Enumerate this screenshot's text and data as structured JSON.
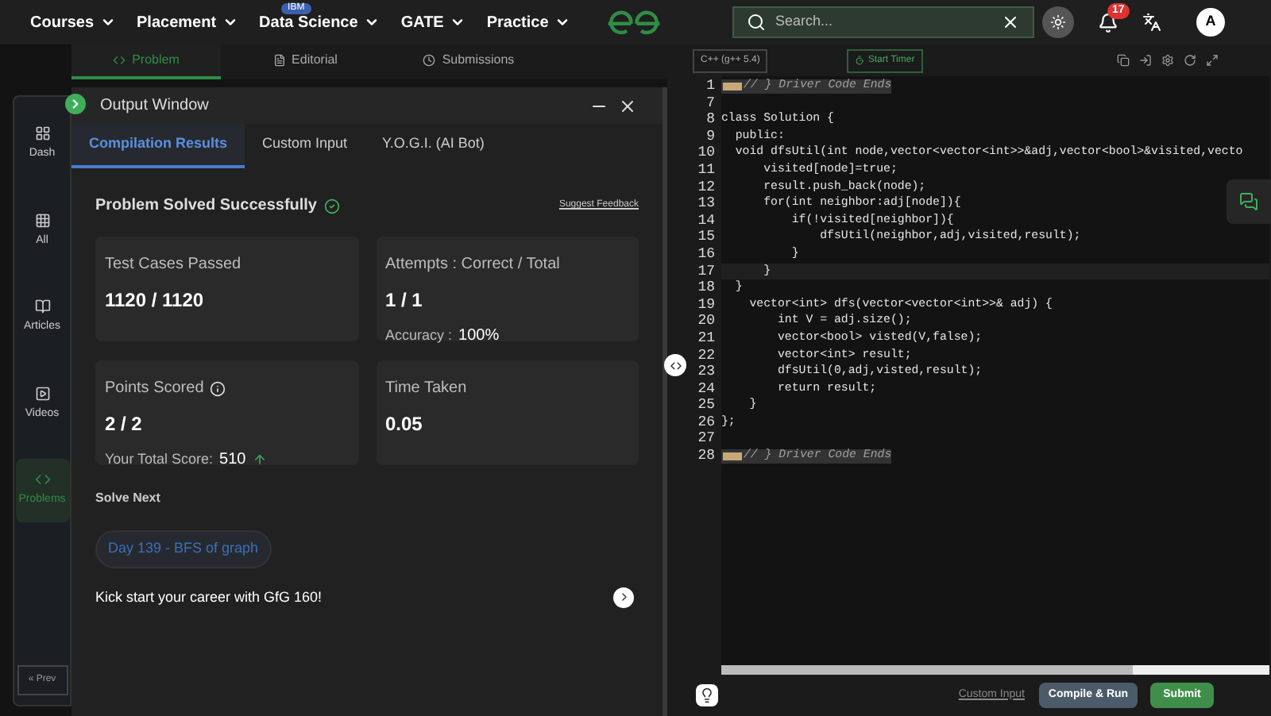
{
  "nav": {
    "items": [
      {
        "label": "Courses"
      },
      {
        "label": "Placement"
      },
      {
        "label": "Data Science",
        "badge": "IBM"
      },
      {
        "label": "GATE"
      },
      {
        "label": "Practice"
      }
    ],
    "search": {
      "placeholder": "Search..."
    },
    "notifications": "17",
    "avatar": "A"
  },
  "problem_tabs": [
    {
      "label": "Problem",
      "selected": true
    },
    {
      "label": "Editorial",
      "selected": false
    },
    {
      "label": "Submissions",
      "selected": false
    }
  ],
  "sidebar": {
    "items": [
      {
        "label": "Dash",
        "selected": false
      },
      {
        "label": "All",
        "selected": false
      },
      {
        "label": "Articles",
        "selected": false
      },
      {
        "label": "Videos",
        "selected": false
      },
      {
        "label": "Problems",
        "selected": true
      }
    ],
    "prev": "« Prev"
  },
  "output": {
    "title": "Output Window",
    "tabs": [
      {
        "label": "Compilation Results",
        "selected": true
      },
      {
        "label": "Custom Input",
        "selected": false
      },
      {
        "label": "Y.O.G.I. (AI Bot)",
        "selected": false
      }
    ],
    "status": "Problem Solved Successfully",
    "feedback": "Suggest Feedback",
    "cards": [
      {
        "title": "Test Cases Passed",
        "value": "1120 / 1120"
      },
      {
        "title": "Attempts : Correct / Total",
        "value": "1 / 1",
        "note_label": "Accuracy :",
        "note_value": "100%"
      },
      {
        "title": "Points Scored",
        "value": "2 / 2",
        "info": true,
        "note_label": "Your Total Score:",
        "note_value": "510",
        "trend_up": true
      },
      {
        "title": "Time Taken",
        "value": "0.05"
      }
    ],
    "solve_next": "Solve Next",
    "next_problem": "Day 139 - BFS of graph",
    "promo": "Kick start your career with GfG 160!"
  },
  "editor": {
    "language": "C++ (g++ 5.4)",
    "timer": "Start Timer",
    "lines": [
      {
        "number": "1",
        "kind": "comment",
        "text": "// } Driver Code Ends",
        "active": false
      },
      {
        "number": "7",
        "kind": "code",
        "active": false
      },
      {
        "number": "8",
        "kind": "code",
        "text": "class Solution {",
        "active": false
      },
      {
        "number": "9",
        "kind": "code",
        "text": "  public:",
        "active": false
      },
      {
        "number": "10",
        "kind": "code",
        "text": "  void dfsUtil(int node,vector<vector<int>>&adj,vector<bool>&visited,vecto",
        "active": false
      },
      {
        "number": "11",
        "kind": "code",
        "text": "      visited[node]=true;",
        "active": false
      },
      {
        "number": "12",
        "kind": "code",
        "text": "      result.push_back(node);",
        "active": false
      },
      {
        "number": "13",
        "kind": "code",
        "text": "      for(int neighbor:adj[node]){",
        "active": false
      },
      {
        "number": "14",
        "kind": "code",
        "text": "          if(!visited[neighbor]){",
        "active": false
      },
      {
        "number": "15",
        "kind": "code",
        "text": "              dfsUtil(neighbor,adj,visited,result);",
        "active": false
      },
      {
        "number": "16",
        "kind": "code",
        "text": "          }",
        "active": false
      },
      {
        "number": "17",
        "kind": "code",
        "text": "      }",
        "active": true
      },
      {
        "number": "18",
        "kind": "code",
        "text": "  }",
        "active": false
      },
      {
        "number": "19",
        "kind": "code",
        "text": "    vector<int> dfs(vector<vector<int>>& adj) {",
        "active": false
      },
      {
        "number": "20",
        "kind": "code",
        "text": "        int V = adj.size();",
        "active": false
      },
      {
        "number": "21",
        "kind": "code",
        "text": "        vector<bool> visted(V,false);",
        "active": false
      },
      {
        "number": "22",
        "kind": "code",
        "text": "        vector<int> result;",
        "active": false
      },
      {
        "number": "23",
        "kind": "code",
        "text": "        dfsUtil(0,adj,visted,result);",
        "active": false
      },
      {
        "number": "24",
        "kind": "code",
        "text": "        return result;",
        "active": false
      },
      {
        "number": "25",
        "kind": "code",
        "text": "    }",
        "active": false
      },
      {
        "number": "26",
        "kind": "code",
        "text": "};",
        "active": false
      },
      {
        "number": "27",
        "kind": "code",
        "active": false
      },
      {
        "number": "28",
        "kind": "comment",
        "text": "// } Driver Code Ends",
        "active": false
      }
    ],
    "custom_input": "Custom Input",
    "compile": "Compile & Run",
    "submit": "Submit"
  }
}
